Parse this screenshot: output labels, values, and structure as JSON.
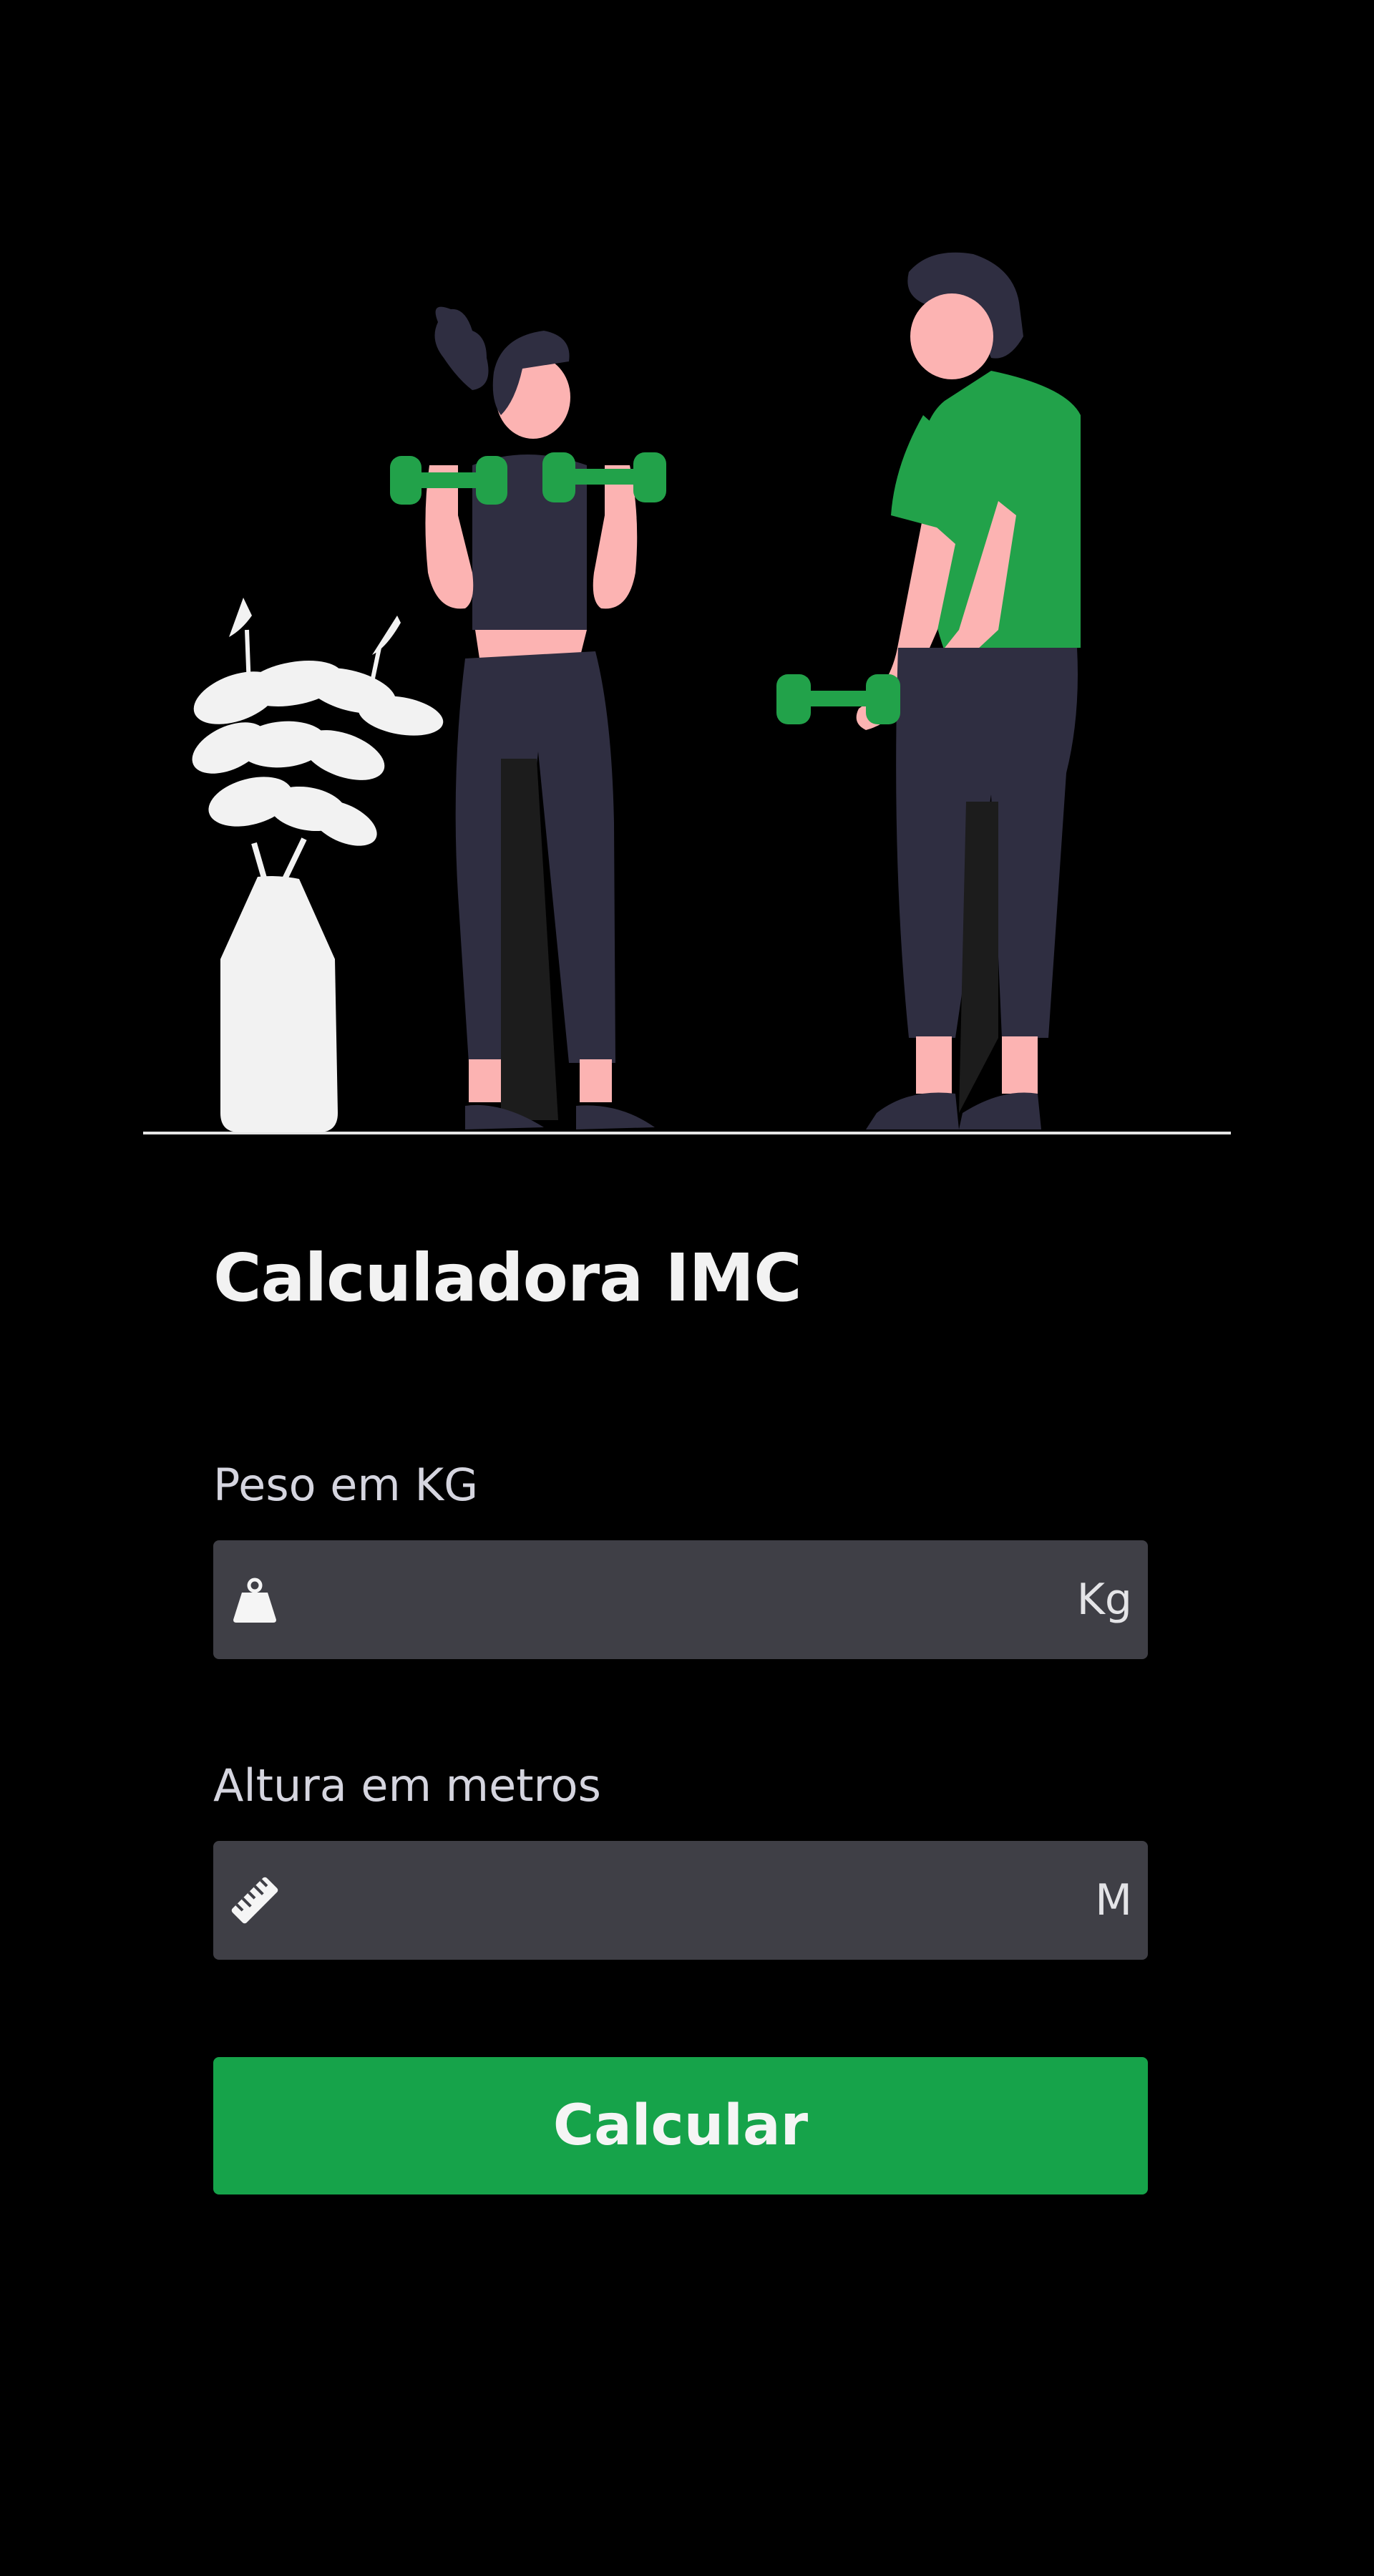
{
  "colors": {
    "background": "#000000",
    "accent": "#16a34a",
    "input_bg": "#3f3f46",
    "figure_dark": "#2f2e41",
    "skin": "#fcb3b2",
    "plant": "#f2f2f2"
  },
  "form": {
    "title": "Calculadora IMC",
    "weight": {
      "label": "Peso em KG",
      "icon": "weight-icon",
      "unit": "Kg",
      "value": ""
    },
    "height": {
      "label": "Altura em metros",
      "icon": "ruler-icon",
      "unit": "M",
      "value": ""
    },
    "submit_label": "Calcular"
  }
}
